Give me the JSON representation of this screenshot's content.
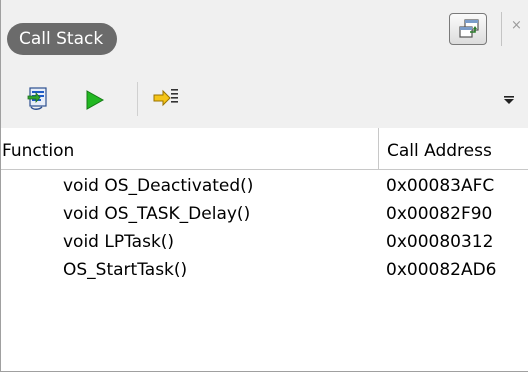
{
  "window": {
    "title": "Call Stack",
    "close_glyph": "×"
  },
  "toolbar": {
    "icons": [
      "step-into-frame-icon",
      "run-icon",
      "set-pc-icon",
      "dropdown-arrow-icon"
    ]
  },
  "table": {
    "columns": [
      "Function",
      "Call Address"
    ],
    "rows": [
      {
        "function": "void OS_Deactivated()",
        "address": "0x00083AFC"
      },
      {
        "function": "void OS_TASK_Delay()",
        "address": "0x00082F90"
      },
      {
        "function": "void LPTask()",
        "address": "0x00080312"
      },
      {
        "function": "OS_StartTask()",
        "address": "0x00082AD6"
      }
    ]
  },
  "colors": {
    "chrome_bg": "#f0f0f0",
    "title_pill": "#6b6b6b",
    "run_green": "#22b822",
    "accent_blue": "#1e5bc6"
  }
}
